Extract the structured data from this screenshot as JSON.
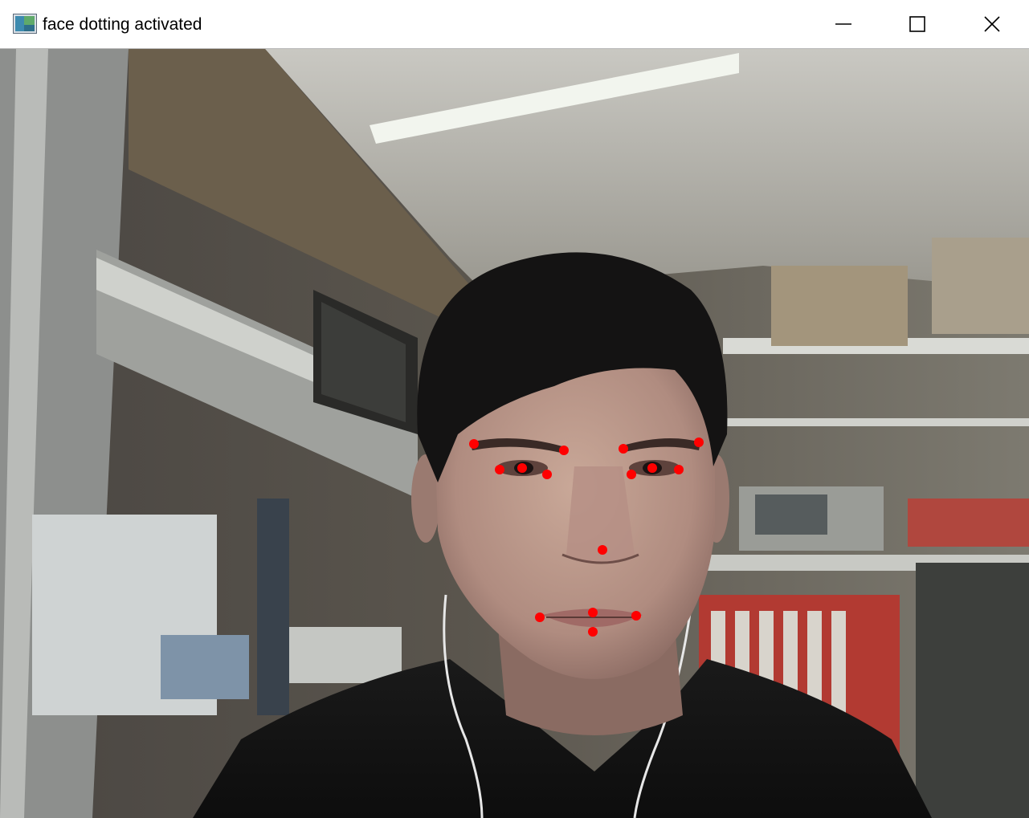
{
  "window": {
    "title": "face dotting activated",
    "icon": "opencv-window-icon",
    "controls": {
      "minimize": "minimize-icon",
      "maximize": "maximize-icon",
      "close": "close-icon"
    }
  },
  "frame": {
    "description_icon": "webcam-feed",
    "landmark_color": "#ff0000"
  }
}
